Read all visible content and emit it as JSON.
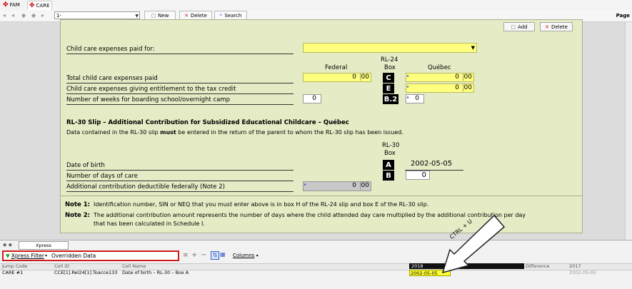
{
  "tabs": [
    {
      "label": "FAM"
    },
    {
      "label": "CARE"
    }
  ],
  "toolbar": {
    "combo_value": "1-",
    "new_label": "New",
    "delete_label": "Delete",
    "search_label": "Search",
    "page_label": "Page"
  },
  "form": {
    "add_label": "Add",
    "delete_label": "Delete",
    "paid_for_label": "Child care expenses paid for:",
    "federal_header": "Federal",
    "rl24_header": "RL-24",
    "box_header": "Box",
    "quebec_header": "Québec",
    "rows": [
      {
        "label": "Total child care expenses paid",
        "box": "C",
        "federal": "0",
        "federal_cents": "00",
        "quebec": "0",
        "quebec_cents": "00"
      },
      {
        "label": "Child care expenses giving entitlement to the tax credit",
        "box": "E",
        "quebec": "0",
        "quebec_cents": "00"
      },
      {
        "label": "Number of weeks for boarding school/overnight camp",
        "box": "B.2",
        "federal": "0",
        "quebec": "0"
      }
    ],
    "rl30_title": "RL-30 Slip – Additional Contribution for Subsidized Educational Childcare – Québec",
    "rl30_note_pre": "Data contained in the RL-30 slip ",
    "rl30_note_bold": "must",
    "rl30_note_post": " be entered in the return of the parent to whom the RL-30 slip has been issued.",
    "rl30_header": "RL-30",
    "rl30_box_header": "Box",
    "dob_label": "Date of birth",
    "dob_box": "A",
    "dob_value": "2002-05-05",
    "days_label": "Number of days of care",
    "days_box": "B",
    "days_value": "0",
    "addl_label": "Additional contribution deductible federally (Note 2)",
    "addl_value": "0",
    "addl_cents": "00",
    "note1_label": "Note 1:",
    "note1_text": "Identification number, SIN or NEQ that you must enter above is in box H of the RL-24 slip and box E of the RL-30 slip.",
    "note2_label": "Note 2:",
    "note2_text_1": "The additional contribution amount represents the number of days where the child attended day care multiplied by the additional contribution per day",
    "note2_text_2": "that has been calculated in Schedule I."
  },
  "bottom": {
    "xpress_combo": "Xpress",
    "filter_label": "Xpress Filter",
    "filter_value": "Overridden Data",
    "columns_label": "Columns",
    "headers": {
      "jump": "Jump Code",
      "cell": "Cell ID",
      "name": "Cell Name",
      "y2018": "2018",
      "diff": "Difference",
      "y2017": "2017"
    },
    "row": {
      "jump": "CARE #1",
      "cell": "CCE[1].Rel24[1].Toacce133",
      "name": "Date of birth – RL-30 – Box A",
      "y2018": "2002-05-05",
      "y2017": "2002-05-05"
    }
  },
  "callout": {
    "text": "CTRL + U"
  },
  "colors": {
    "form_bg": "#e5ecc5",
    "yellow": "#ffff7f",
    "filter_border": "#d11b1b"
  }
}
